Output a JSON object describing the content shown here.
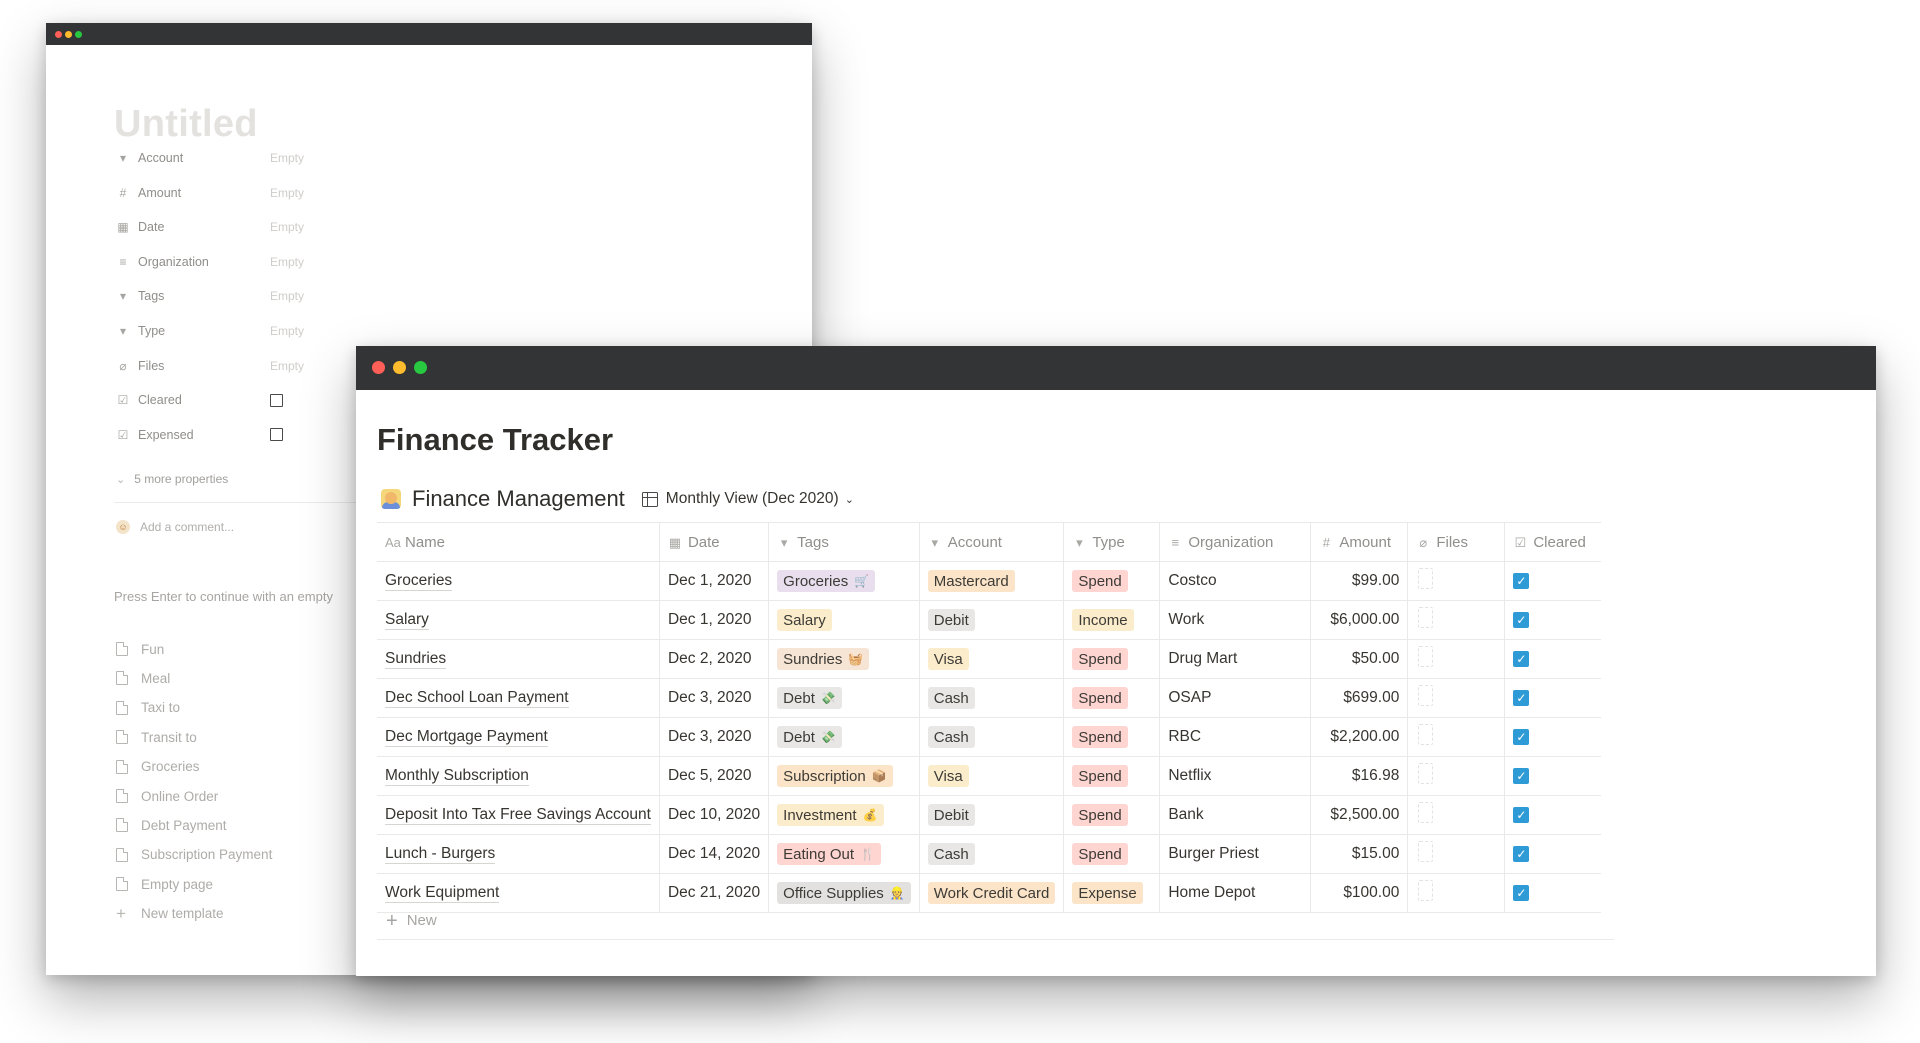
{
  "template_window": {
    "title": "Untitled",
    "properties": [
      {
        "icon": "select-icon",
        "glyph": "▾",
        "label": "Account",
        "value": "Empty"
      },
      {
        "icon": "number-icon",
        "glyph": "#",
        "label": "Amount",
        "value": "Empty"
      },
      {
        "icon": "calendar-icon",
        "glyph": "▦",
        "label": "Date",
        "value": "Empty"
      },
      {
        "icon": "text-icon",
        "glyph": "≡",
        "label": "Organization",
        "value": "Empty"
      },
      {
        "icon": "select-icon",
        "glyph": "▾",
        "label": "Tags",
        "value": "Empty"
      },
      {
        "icon": "select-icon",
        "glyph": "▾",
        "label": "Type",
        "value": "Empty"
      },
      {
        "icon": "paperclip-icon",
        "glyph": "⌀",
        "label": "Files",
        "value": "Empty"
      },
      {
        "icon": "checkbox-icon",
        "glyph": "☑",
        "label": "Cleared",
        "checked": false
      },
      {
        "icon": "checkbox-icon",
        "glyph": "☑",
        "label": "Expensed",
        "checked": false
      }
    ],
    "more_properties": "5 more properties",
    "comment_placeholder": "Add a comment...",
    "hint": "Press Enter to continue with an empty",
    "templates": [
      "Fun",
      "Meal",
      "Taxi to",
      "Transit to",
      "Groceries",
      "Online Order",
      "Debt Payment",
      "Subscription Payment",
      "Empty page"
    ],
    "new_template": "New template"
  },
  "main_window": {
    "page_title": "Finance Tracker",
    "database_title": "Finance Management",
    "view_label": "Monthly View (Dec 2020)",
    "columns": [
      {
        "key": "name",
        "label": "Name",
        "icon": "title-icon",
        "glyph": "Aa"
      },
      {
        "key": "date",
        "label": "Date",
        "icon": "calendar-icon",
        "glyph": "▦"
      },
      {
        "key": "tags",
        "label": "Tags",
        "icon": "select-icon",
        "glyph": "▾"
      },
      {
        "key": "account",
        "label": "Account",
        "icon": "select-icon",
        "glyph": "▾"
      },
      {
        "key": "type",
        "label": "Type",
        "icon": "select-icon",
        "glyph": "▾"
      },
      {
        "key": "organization",
        "label": "Organization",
        "icon": "text-icon",
        "glyph": "≡"
      },
      {
        "key": "amount",
        "label": "Amount",
        "icon": "number-icon",
        "glyph": "#"
      },
      {
        "key": "files",
        "label": "Files",
        "icon": "paperclip-icon",
        "glyph": "⌀"
      },
      {
        "key": "cleared",
        "label": "Cleared",
        "icon": "checkbox-icon",
        "glyph": "☑"
      }
    ],
    "rows": [
      {
        "name": "Groceries",
        "date": "Dec 1, 2020",
        "tag": "Groceries",
        "tag_emoji": "🛒",
        "tag_color": "#e8deee",
        "account": "Mastercard",
        "account_color": "#fbe4c8",
        "type": "Spend",
        "type_color": "#ffd5d2",
        "organization": "Costco",
        "amount": "$99.00",
        "cleared": true
      },
      {
        "name": "Salary",
        "date": "Dec 1, 2020",
        "tag": "Salary",
        "tag_emoji": "",
        "tag_color": "#fbeccc",
        "account": "Debit",
        "account_color": "#e8e7e5",
        "type": "Income",
        "type_color": "#fbeccc",
        "organization": "Work",
        "amount": "$6,000.00",
        "cleared": true
      },
      {
        "name": "Sundries",
        "date": "Dec 2, 2020",
        "tag": "Sundries",
        "tag_emoji": "🧺",
        "tag_color": "#f6e4d4",
        "account": "Visa",
        "account_color": "#fbeccc",
        "type": "Spend",
        "type_color": "#ffd5d2",
        "organization": "Drug Mart",
        "amount": "$50.00",
        "cleared": true
      },
      {
        "name": "Dec School Loan Payment",
        "date": "Dec 3, 2020",
        "tag": "Debt",
        "tag_emoji": "💸",
        "tag_color": "#e8e7e5",
        "account": "Cash",
        "account_color": "#e8e7e5",
        "type": "Spend",
        "type_color": "#ffd5d2",
        "organization": "OSAP",
        "amount": "$699.00",
        "cleared": true
      },
      {
        "name": "Dec Mortgage Payment",
        "date": "Dec 3, 2020",
        "tag": "Debt",
        "tag_emoji": "💸",
        "tag_color": "#e8e7e5",
        "account": "Cash",
        "account_color": "#e8e7e5",
        "type": "Spend",
        "type_color": "#ffd5d2",
        "organization": "RBC",
        "amount": "$2,200.00",
        "cleared": true
      },
      {
        "name": "Monthly Subscription",
        "date": "Dec 5, 2020",
        "tag": "Subscription",
        "tag_emoji": "📦",
        "tag_color": "#fbe4c8",
        "account": "Visa",
        "account_color": "#fbeccc",
        "type": "Spend",
        "type_color": "#ffd5d2",
        "organization": "Netflix",
        "amount": "$16.98",
        "cleared": true
      },
      {
        "name": "Deposit Into Tax Free Savings Account",
        "date": "Dec 10, 2020",
        "tag": "Investment",
        "tag_emoji": "💰",
        "tag_color": "#fbeccc",
        "account": "Debit",
        "account_color": "#e8e7e5",
        "type": "Spend",
        "type_color": "#ffd5d2",
        "organization": "Bank",
        "amount": "$2,500.00",
        "cleared": true
      },
      {
        "name": "Lunch - Burgers",
        "date": "Dec 14, 2020",
        "tag": "Eating Out",
        "tag_emoji": "🍴",
        "tag_color": "#ffd5d2",
        "account": "Cash",
        "account_color": "#e8e7e5",
        "type": "Spend",
        "type_color": "#ffd5d2",
        "organization": "Burger Priest",
        "amount": "$15.00",
        "cleared": true
      },
      {
        "name": "Work Equipment",
        "date": "Dec 21, 2020",
        "tag": "Office Supplies",
        "tag_emoji": "👷",
        "tag_color": "#e2e1df",
        "account": "Work Credit Card",
        "account_color": "#fbe4c8",
        "type": "Expense",
        "type_color": "#fbe4c8",
        "organization": "Home Depot",
        "amount": "$100.00",
        "cleared": true
      }
    ],
    "new_row_label": "New"
  },
  "colors": {
    "titlebar": "#333436",
    "checkbox_checked": "#2e9bd6",
    "traffic_red": "#fe5f57",
    "traffic_yellow": "#febb2e",
    "traffic_green": "#28c840"
  }
}
